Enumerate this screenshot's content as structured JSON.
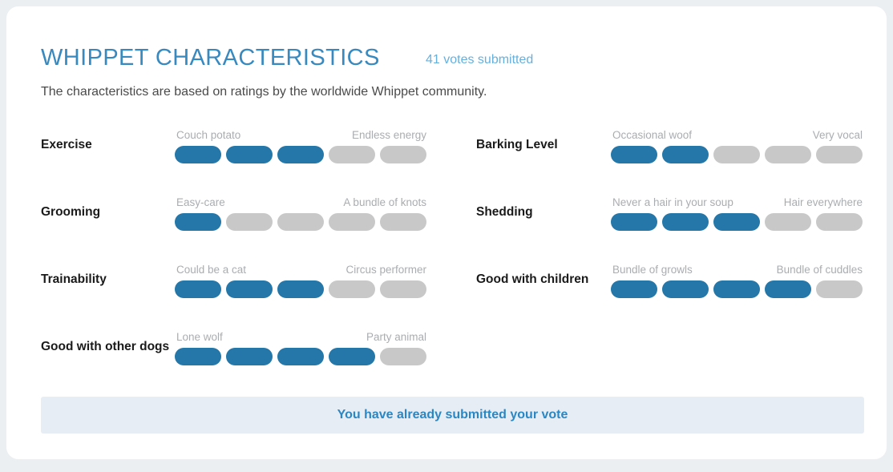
{
  "header": {
    "title": "WHIPPET CHARACTERISTICS",
    "votes": "41 votes submitted",
    "subtitle": "The characteristics are based on ratings by the worldwide Whippet community."
  },
  "colors": {
    "accent": "#2477a8",
    "title": "#3889bf",
    "empty_pill": "#c8c8c8",
    "banner_bg": "#e6edf5",
    "banner_text": "#2a87c4",
    "page_bg": "#eceff1",
    "card_bg": "#ffffff"
  },
  "scale": {
    "max": 5
  },
  "characteristics": [
    {
      "label": "Exercise",
      "low": "Couch potato",
      "high": "Endless energy",
      "value": 3,
      "column": "left"
    },
    {
      "label": "Barking Level",
      "low": "Occasional woof",
      "high": "Very vocal",
      "value": 2,
      "column": "right"
    },
    {
      "label": "Grooming",
      "low": "Easy-care",
      "high": "A bundle of knots",
      "value": 1,
      "column": "left"
    },
    {
      "label": "Shedding",
      "low": "Never a hair in your soup",
      "high": "Hair everywhere",
      "value": 3,
      "column": "right"
    },
    {
      "label": "Trainability",
      "low": "Could be a cat",
      "high": "Circus performer",
      "value": 3,
      "column": "left"
    },
    {
      "label": "Good with children",
      "low": "Bundle of growls",
      "high": "Bundle of cuddles",
      "value": 4,
      "column": "right"
    },
    {
      "label": "Good with other dogs",
      "low": "Lone wolf",
      "high": "Party animal",
      "value": 4,
      "column": "left"
    }
  ],
  "banner": {
    "message": "You have already submitted your vote"
  }
}
